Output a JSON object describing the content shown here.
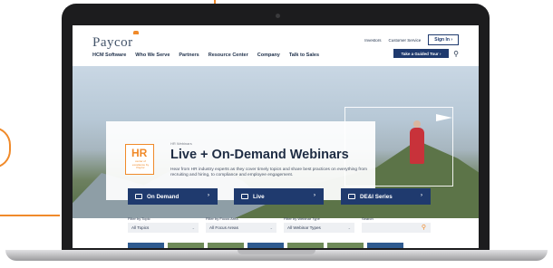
{
  "brand": {
    "logo_text": "Paycor",
    "accent": "#f08a2a",
    "navy": "#1f3a6e"
  },
  "nav": {
    "menu": [
      "HCM Software",
      "Who We Serve",
      "Partners",
      "Resource Center",
      "Company",
      "Talk to Sales"
    ],
    "utility": {
      "investors": "Investors",
      "customer_service": "Customer Service",
      "sign_in": "Sign In"
    },
    "tour_button": "Take a Guided Tour"
  },
  "hero": {
    "eyebrow": "HR Webinars",
    "title": "Live + On-Demand Webinars",
    "description": "Hear from HR industry experts as they cover timely topics and share best practices on everything from recruiting and hiring, to compliance and employee engagement.",
    "hr_logo": {
      "mark": "HR",
      "sub": "center of excellence by Paycor"
    }
  },
  "tabs": [
    {
      "label": "On Demand"
    },
    {
      "label": "Live"
    },
    {
      "label": "DE&I Series"
    }
  ],
  "filters": {
    "topic": {
      "label": "Filter by Topic",
      "value": "All Topics"
    },
    "focus": {
      "label": "Filter by Focus Area",
      "value": "All Focus Areas"
    },
    "type": {
      "label": "Filter by Webinar Type",
      "value": "All Webinar Types"
    },
    "search": {
      "label": "Search",
      "placeholder": ""
    }
  }
}
